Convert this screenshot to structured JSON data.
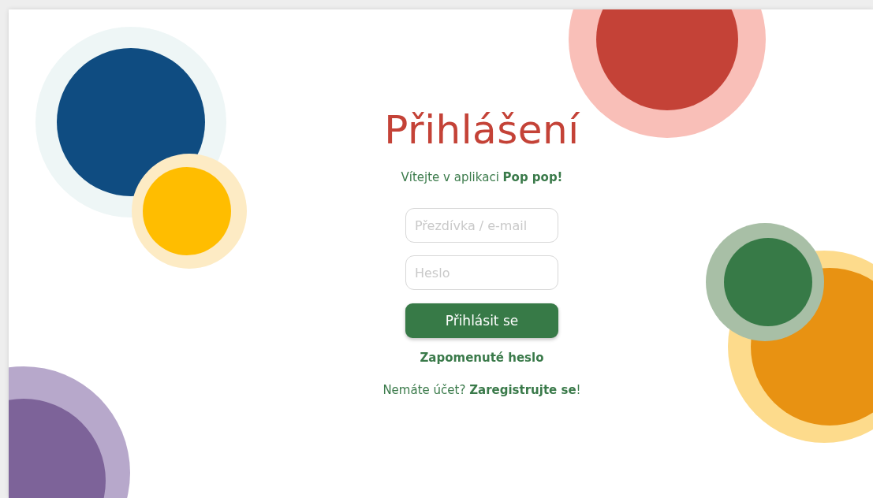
{
  "title": "Přihlášení",
  "welcome": "Vítejte v aplikaci **Pop pop!**",
  "fields": [
    {
      "placeholder": "Přezdívka / e-mail"
    },
    {
      "placeholder": "Heslo"
    }
  ],
  "submit_button": "Přihlásit se",
  "forgot_link": "Zapomenuté heslo",
  "register": {
    "text": "Nemáte účet?",
    "link": "Zaregistrujte se",
    "suffix": "!"
  }
}
